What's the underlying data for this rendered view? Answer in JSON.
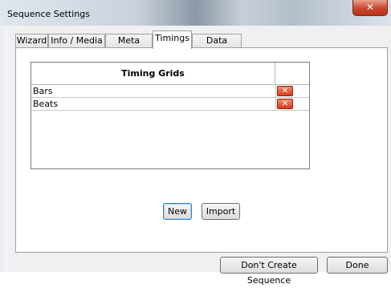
{
  "window": {
    "title": "Sequence Settings",
    "close_glyph": "✕"
  },
  "tabs": [
    {
      "label": "Wizard",
      "active": false
    },
    {
      "label": "Info / Media",
      "active": false
    },
    {
      "label": "Meta Data",
      "active": false
    },
    {
      "label": "Timings",
      "active": true
    },
    {
      "label": "Data Layers",
      "active": false
    }
  ],
  "timing_grid": {
    "header": "Timing Grids",
    "rows": [
      {
        "label": "Bars"
      },
      {
        "label": "Beats"
      }
    ],
    "delete_glyph": "✕",
    "delete_color": "#d83c1c"
  },
  "buttons": {
    "new_label": "New",
    "import_label": "Import",
    "dont_create_label": "Don't Create Sequence",
    "done_label": "Done"
  }
}
